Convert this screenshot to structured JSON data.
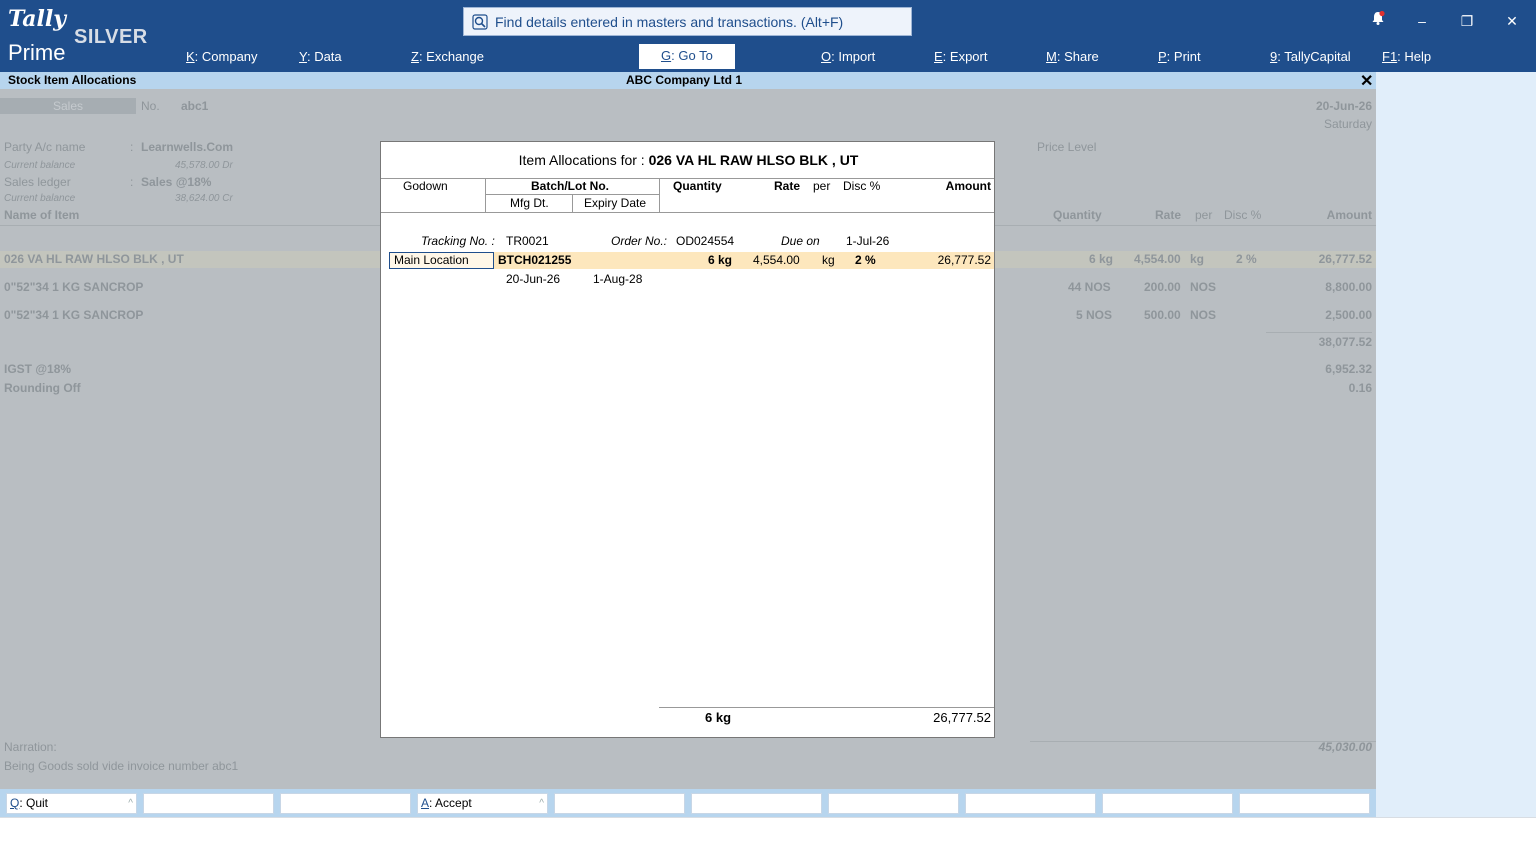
{
  "app": {
    "logo_tally": "Tally",
    "logo_prime": "Prime",
    "edition": "SILVER",
    "search_placeholder": "Find details entered in masters and transactions. (Alt+F)"
  },
  "menu": [
    {
      "key": "K",
      "label": ": Company"
    },
    {
      "key": "Y",
      "label": ": Data"
    },
    {
      "key": "Z",
      "label": ": Exchange"
    },
    {
      "key": "G",
      "label": ": Go To"
    },
    {
      "key": "O",
      "label": ": Import"
    },
    {
      "key": "E",
      "label": ": Export"
    },
    {
      "key": "M",
      "label": ": Share"
    },
    {
      "key": "P",
      "label": ": Print"
    },
    {
      "key": "9",
      "label": ": TallyCapital"
    },
    {
      "key": "F1",
      "label": ": Help"
    }
  ],
  "titlebar": {
    "screen": "Stock Item Allocations",
    "company": "ABC Company Ltd 1"
  },
  "voucher": {
    "type": "Sales",
    "no_label": "No.",
    "no": "abc1",
    "date": "20-Jun-26",
    "day": "Saturday",
    "party_label": "Party A/c name",
    "party": "Learnwells.Com",
    "party_bal_label": "Current balance",
    "party_bal": "45,578.00 Dr",
    "sales_ledger_label": "Sales ledger",
    "sales_ledger": "Sales @18%",
    "sales_bal_label": "Current balance",
    "sales_bal": "38,624.00 Cr",
    "price_level_label": "Price Level",
    "columns": {
      "name": "Name of Item",
      "qty": "Quantity",
      "rate": "Rate",
      "per": "per",
      "disc": "Disc %",
      "amount": "Amount"
    },
    "items": [
      {
        "name": "026 VA HL RAW HLSO BLK , UT",
        "qty": "6 kg",
        "rate": "4,554.00",
        "per": "kg",
        "disc": "2 %",
        "amount": "26,777.52"
      },
      {
        "name": "0\"52\"34 1 KG SANCROP",
        "qty": "44 NOS",
        "rate": "200.00",
        "per": "NOS",
        "disc": "",
        "amount": "8,800.00"
      },
      {
        "name": "0\"52\"34 1 KG SANCROP",
        "qty": "5 NOS",
        "rate": "500.00",
        "per": "NOS",
        "disc": "",
        "amount": "2,500.00"
      }
    ],
    "subtotal": "38,077.52",
    "igst_label": "IGST @18%",
    "igst": "6,952.32",
    "rounding_label": "Rounding Off",
    "rounding": "0.16",
    "narration_label": "Narration:",
    "narration": "Being Goods sold vide invoice number abc1",
    "total": "45,030.00"
  },
  "dialog": {
    "title_label": "Item Allocations for :",
    "title_item": "026 VA HL RAW HLSO BLK , UT",
    "col_godown": "Godown",
    "col_batch": "Batch/Lot No.",
    "col_mfg": "Mfg Dt.",
    "col_expiry": "Expiry Date",
    "col_qty": "Quantity",
    "col_rate": "Rate",
    "col_per": "per",
    "col_disc": "Disc %",
    "col_amount": "Amount",
    "tracking_label": "Tracking No. :",
    "tracking": "TR0021",
    "order_label": "Order No.:",
    "order": "OD024554",
    "due_label": "Due on",
    "due": "1-Jul-26",
    "row": {
      "godown": "Main Location",
      "batch": "BTCH021255",
      "qty": "6 kg",
      "rate": "4,554.00",
      "per": "kg",
      "disc": "2 %",
      "amount": "26,777.52",
      "mfg": "20-Jun-26",
      "expiry": "1-Aug-28"
    },
    "total_qty": "6 kg",
    "total_amount": "26,777.52"
  },
  "bottom": {
    "quit_key": "Q",
    "quit_label": ": Quit",
    "accept_key": "A",
    "accept_label": ": Accept"
  }
}
